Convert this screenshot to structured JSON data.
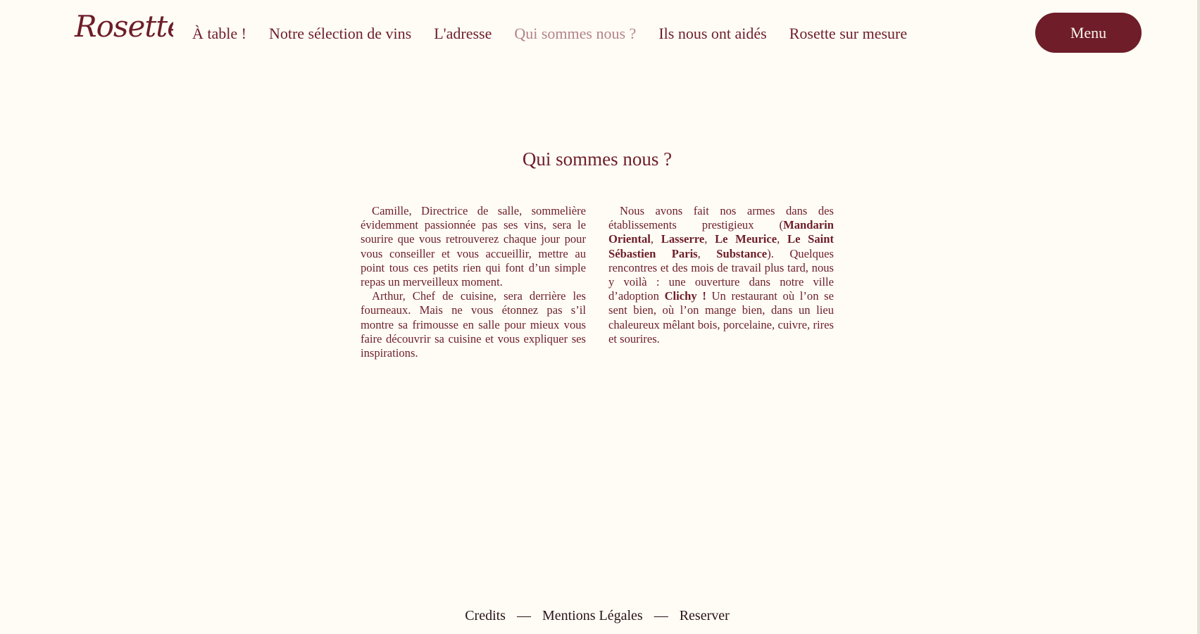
{
  "brand": {
    "logo_text": "Rosette"
  },
  "nav": {
    "items": [
      {
        "label": "À table !"
      },
      {
        "label": "Notre sélection de vins"
      },
      {
        "label": "L'adresse"
      },
      {
        "label": "Qui sommes nous ?",
        "active": true
      },
      {
        "label": "Ils nous ont aidés"
      },
      {
        "label": "Rosette sur mesure"
      }
    ],
    "menu_button": "Menu"
  },
  "page": {
    "title": "Qui sommes nous ?",
    "left_column": {
      "p1": "Camille, Directrice de salle, sommelière évidemment passionnée pas ses vins, sera le sourire que vous retrouverez chaque jour pour vous conseiller et vous accueillir, mettre au point tous ces petits rien qui font d’un simple repas un merveilleux moment.",
      "p2": "Arthur, Chef de cuisine, sera derrière les fourneaux. Mais ne vous étonnez pas s’il montre sa frimousse en salle pour mieux vous faire découvrir sa cuisine et vous expliquer ses inspirations."
    },
    "right_column": {
      "intro": "Nous avons fait nos armes dans des établissements prestigieux (",
      "places": [
        "Mandarin Oriental",
        "Lasserre",
        "Le Meurice",
        "Le Saint Sébastien Paris",
        "Substance"
      ],
      "sep": ", ",
      "after_places": "). Quelques rencontres et des mois de travail plus tard, nous y voilà : une ouverture dans notre ville d’adoption ",
      "city": "Clichy !",
      "outro": " Un restaurant où l’on se sent bien, où l’on mange bien, dans un lieu chaleureux mêlant bois, porcelaine, cuivre, rires et sourires."
    }
  },
  "footer": {
    "links": [
      "Credits",
      "Mentions Légales",
      "Reserver"
    ],
    "separator": "—"
  },
  "colors": {
    "background": "#fefcf5",
    "brand": "#6e1d29",
    "nav_active": "#b5838a",
    "footer_text": "#2a1417",
    "button_text": "#fbf4ea"
  }
}
